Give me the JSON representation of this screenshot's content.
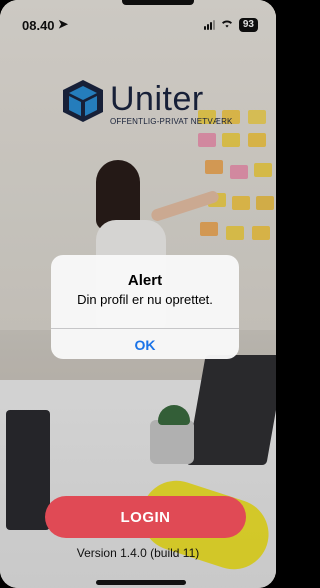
{
  "status_bar": {
    "time": "08.40",
    "location_glyph": "➤",
    "battery": "93"
  },
  "logo": {
    "name": "Uniter",
    "tagline": "OFFENTLIG-PRIVAT NETVÆRK"
  },
  "alert": {
    "title": "Alert",
    "message": "Din profil er nu oprettet.",
    "ok_label": "OK"
  },
  "login": {
    "button_label": "LOGIN",
    "version": "Version 1.4.0 (build 11)"
  },
  "colors": {
    "login_button": "#e04a55",
    "alert_action": "#1a73e8",
    "logo_dark": "#1b2540"
  }
}
